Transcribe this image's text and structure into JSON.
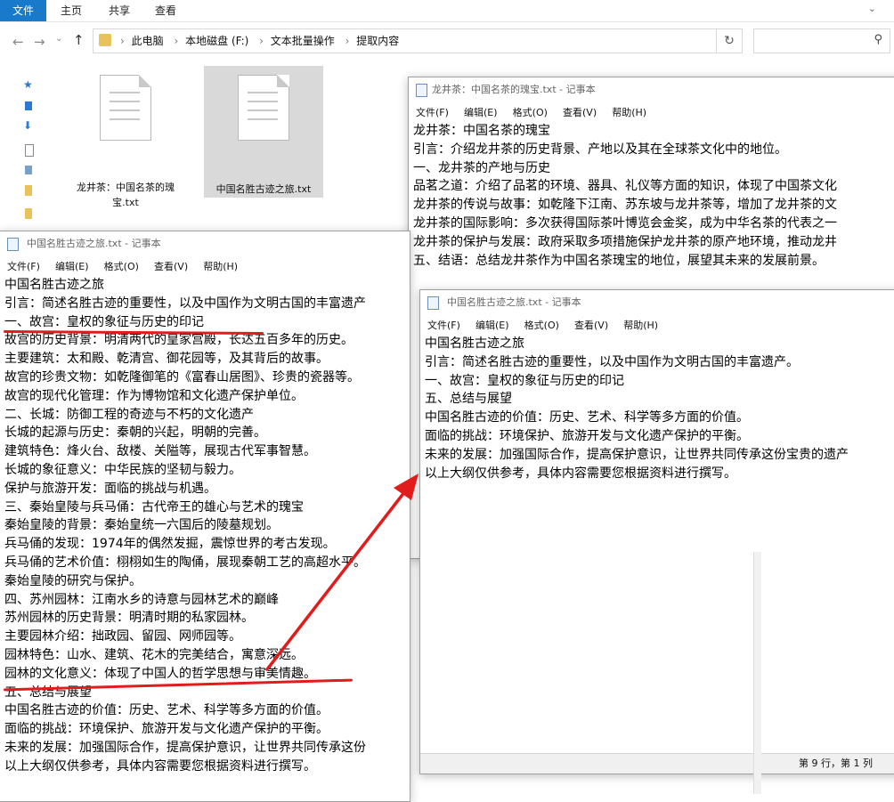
{
  "explorer": {
    "ribbon_tabs": [
      "文件",
      "主页",
      "共享",
      "查看"
    ],
    "breadcrumbs": [
      "此电脑",
      "本地磁盘 (F:)",
      "文本批量操作",
      "提取内容"
    ],
    "files": [
      {
        "name": "龙井茶：中国名茶的瑰宝.txt",
        "line1": "龙井茶：中国名茶的瑰",
        "line2": "宝.txt",
        "selected": false
      },
      {
        "name": "中国名胜古迹之旅.txt",
        "line1": "中国名胜古迹之旅.txt",
        "line2": "",
        "selected": true
      }
    ],
    "icons": {
      "back": "arrow-left-icon",
      "forward": "arrow-right-icon",
      "recent": "chevron-down-icon",
      "up": "arrow-up-icon",
      "refresh": "refresh-icon",
      "search": "search-icon"
    }
  },
  "notepad_longjing": {
    "title": "龙井茶：中国名茶的瑰宝.txt - 记事本",
    "menu": [
      "文件(F)",
      "编辑(E)",
      "格式(O)",
      "查看(V)",
      "帮助(H)"
    ],
    "lines": [
      "龙井茶：中国名茶的瑰宝",
      "引言：介绍龙井茶的历史背景、产地以及其在全球茶文化中的地位。",
      "一、龙井茶的产地与历史",
      "品茗之道：介绍了品茗的环境、器具、礼仪等方面的知识，体现了中国茶文化",
      "龙井茶的传说与故事：如乾隆下江南、苏东坡与龙井茶等，增加了龙井茶的文",
      "龙井茶的国际影响：多次获得国际茶叶博览会金奖，成为中华名茶的代表之一",
      "龙井茶的保护与发展：政府采取多项措施保护龙井茶的原产地环境，推动龙井",
      "五、结语：总结龙井茶作为中国名茶瑰宝的地位，展望其未来的发展前景。"
    ]
  },
  "notepad_source": {
    "title": "中国名胜古迹之旅.txt - 记事本",
    "menu": [
      "文件(F)",
      "编辑(E)",
      "格式(O)",
      "查看(V)",
      "帮助(H)"
    ],
    "lines": [
      "中国名胜古迹之旅",
      "引言：简述名胜古迹的重要性，以及中国作为文明古国的丰富遗产",
      "一、故宫：皇权的象征与历史的印记",
      "故宫的历史背景：明清两代的皇家宫殿，长达五百多年的历史。",
      "主要建筑：太和殿、乾清宫、御花园等，及其背后的故事。",
      "故宫的珍贵文物：如乾隆御笔的《富春山居图》、珍贵的瓷器等。",
      "故宫的现代化管理：作为博物馆和文化遗产保护单位。",
      "二、长城：防御工程的奇迹与不朽的文化遗产",
      "长城的起源与历史：秦朝的兴起，明朝的完善。",
      "建筑特色：烽火台、敌楼、关隘等，展现古代军事智慧。",
      "长城的象征意义：中华民族的坚韧与毅力。",
      "保护与旅游开发：面临的挑战与机遇。",
      "三、秦始皇陵与兵马俑：古代帝王的雄心与艺术的瑰宝",
      "秦始皇陵的背景：秦始皇统一六国后的陵墓规划。",
      "兵马俑的发现：1974年的偶然发掘，震惊世界的考古发现。",
      "兵马俑的艺术价值：栩栩如生的陶俑，展现秦朝工艺的高超水平。",
      "秦始皇陵的研究与保护。",
      "四、苏州园林：江南水乡的诗意与园林艺术的巅峰",
      "苏州园林的历史背景：明清时期的私家园林。",
      "主要园林介绍：拙政园、留园、网师园等。",
      "园林特色：山水、建筑、花木的完美结合，寓意深远。",
      "园林的文化意义：体现了中国人的哲学思想与审美情趣。",
      "五、总结与展望",
      "中国名胜古迹的价值：历史、艺术、科学等多方面的价值。",
      "面临的挑战：环境保护、旅游开发与文化遗产保护的平衡。",
      "未来的发展：加强国际合作，提高保护意识，让世界共同传承这份",
      "以上大纲仅供参考，具体内容需要您根据资料进行撰写。"
    ]
  },
  "notepad_result": {
    "title": "中国名胜古迹之旅.txt - 记事本",
    "menu": [
      "文件(F)",
      "编辑(E)",
      "格式(O)",
      "查看(V)",
      "帮助(H)"
    ],
    "lines": [
      "中国名胜古迹之旅",
      "引言：简述名胜古迹的重要性，以及中国作为文明古国的丰富遗产。",
      "一、故宫：皇权的象征与历史的印记",
      "五、总结与展望",
      "中国名胜古迹的价值：历史、艺术、科学等多方面的价值。",
      "面临的挑战：环境保护、旅游开发与文化遗产保护的平衡。",
      "未来的发展：加强国际合作，提高保护意识，让世界共同传承这份宝贵的遗产",
      "以上大纲仅供参考，具体内容需要您根据资料进行撰写。"
    ],
    "status": "第 9 行，第 1 列"
  },
  "colors": {
    "annotation": "#e01c1c",
    "file_tab": "#1979ca",
    "selection": "#d9d9d9"
  }
}
